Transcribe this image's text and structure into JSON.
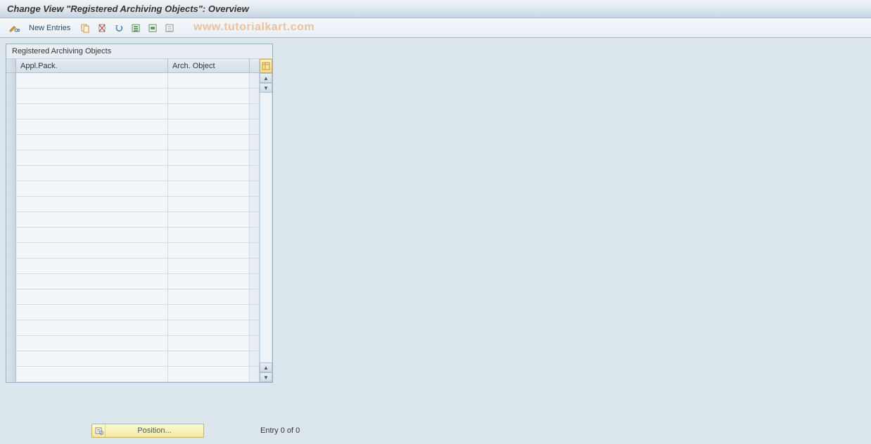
{
  "title": "Change View \"Registered Archiving Objects\": Overview",
  "toolbar": {
    "new_entries_label": "New Entries"
  },
  "watermark": "www.tutorialkart.com",
  "panel": {
    "title": "Registered Archiving Objects",
    "columns": {
      "col1": "Appl.Pack.",
      "col2": "Arch. Object"
    },
    "rows": [
      {
        "c1": "",
        "c2": ""
      },
      {
        "c1": "",
        "c2": ""
      },
      {
        "c1": "",
        "c2": ""
      },
      {
        "c1": "",
        "c2": ""
      },
      {
        "c1": "",
        "c2": ""
      },
      {
        "c1": "",
        "c2": ""
      },
      {
        "c1": "",
        "c2": ""
      },
      {
        "c1": "",
        "c2": ""
      },
      {
        "c1": "",
        "c2": ""
      },
      {
        "c1": "",
        "c2": ""
      },
      {
        "c1": "",
        "c2": ""
      },
      {
        "c1": "",
        "c2": ""
      },
      {
        "c1": "",
        "c2": ""
      },
      {
        "c1": "",
        "c2": ""
      },
      {
        "c1": "",
        "c2": ""
      },
      {
        "c1": "",
        "c2": ""
      },
      {
        "c1": "",
        "c2": ""
      },
      {
        "c1": "",
        "c2": ""
      },
      {
        "c1": "",
        "c2": ""
      },
      {
        "c1": "",
        "c2": ""
      }
    ]
  },
  "footer": {
    "position_label": "Position...",
    "entry_status": "Entry 0 of 0"
  }
}
